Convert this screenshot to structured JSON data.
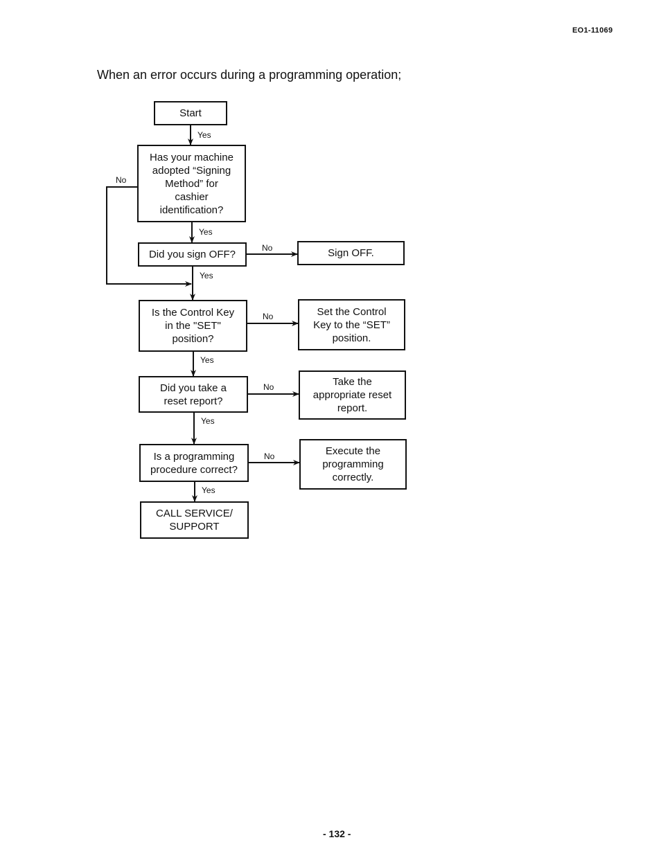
{
  "header": {
    "document_id": "EO1-11069"
  },
  "title": "When an error occurs during a programming operation;",
  "footer": {
    "page_number": "- 132 -"
  },
  "flowchart": {
    "nodes": {
      "start": "Start",
      "q_signing_method": "Has your machine\nadopted “Signing\nMethod” for\ncashier\nidentification?",
      "q_sign_off": "Did you sign OFF?",
      "a_sign_off": "Sign OFF.",
      "q_control_key": "Is the Control Key\nin the \"SET\"\nposition?",
      "a_control_key": "Set the Control\nKey to the “SET”\nposition.",
      "q_reset_report": "Did you take a\nreset report?",
      "a_reset_report": "Take the\nappropriate reset\nreport.",
      "q_procedure": "Is a programming\nprocedure correct?",
      "a_procedure": "Execute the\nprogramming\ncorrectly.",
      "end": "CALL SERVICE/\nSUPPORT"
    },
    "edge_labels": {
      "yes": "Yes",
      "no": "No"
    },
    "edges": [
      {
        "from": "start",
        "to": "q_signing_method",
        "label": "Yes"
      },
      {
        "from": "q_signing_method",
        "to": "q_sign_off",
        "label": "Yes"
      },
      {
        "from": "q_signing_method",
        "to": "q_control_key",
        "label": "No"
      },
      {
        "from": "q_sign_off",
        "to": "a_sign_off",
        "label": "No"
      },
      {
        "from": "q_sign_off",
        "to": "q_control_key",
        "label": "Yes"
      },
      {
        "from": "q_control_key",
        "to": "a_control_key",
        "label": "No"
      },
      {
        "from": "q_control_key",
        "to": "q_reset_report",
        "label": "Yes"
      },
      {
        "from": "q_reset_report",
        "to": "a_reset_report",
        "label": "No"
      },
      {
        "from": "q_reset_report",
        "to": "q_procedure",
        "label": "Yes"
      },
      {
        "from": "q_procedure",
        "to": "a_procedure",
        "label": "No"
      },
      {
        "from": "q_procedure",
        "to": "end",
        "label": "Yes"
      }
    ]
  }
}
